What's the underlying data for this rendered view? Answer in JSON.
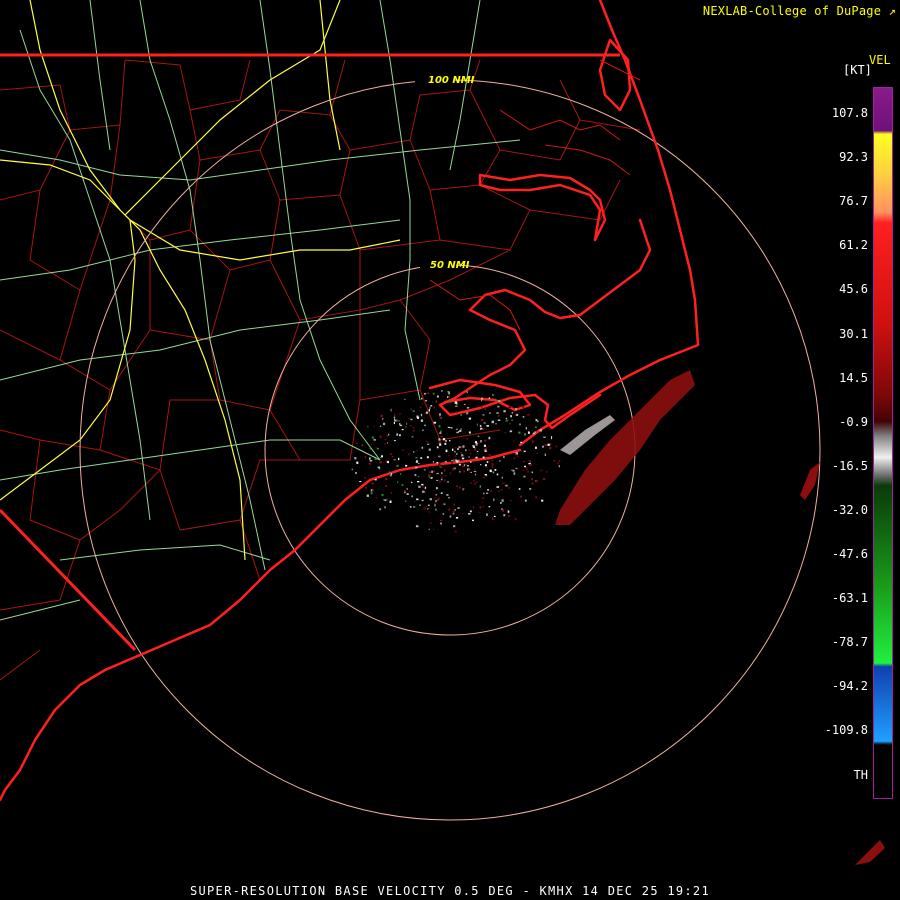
{
  "credit": "NEXLAB-College of DuPage",
  "legend": {
    "title": "VEL",
    "units": "[KT]",
    "ticks": [
      "107.8",
      "92.3",
      "76.7",
      "61.2",
      "45.6",
      "30.1",
      "14.5",
      "-0.9",
      "-16.5",
      "-32.0",
      "-47.6",
      "-63.1",
      "-78.7",
      "-94.2",
      "-109.8",
      "TH"
    ]
  },
  "range_rings": [
    "100 NMI",
    "50 NMI"
  ],
  "footer": "SUPER-RESOLUTION BASE VELOCITY 0.5 DEG - KMHX 14 DEC 25 19:21",
  "colors": {
    "background": "#000000",
    "state_borders": "#ff2020",
    "county_lines": "#c01818",
    "highways_major": "#ffff40",
    "highways_minor": "#a0f0a0",
    "range_rings": "#f0b0a0",
    "text": "#ffff00"
  }
}
